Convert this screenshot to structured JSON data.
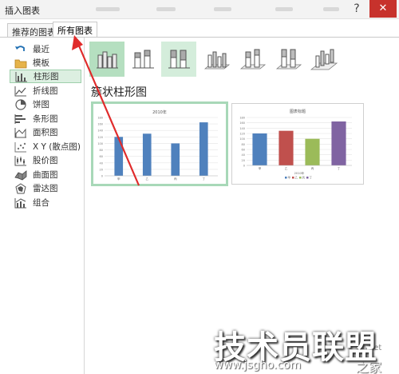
{
  "window": {
    "title": "插入图表",
    "help_label": "?",
    "close_label": "✕"
  },
  "tabs": [
    {
      "label": "推荐的图表"
    },
    {
      "label": "所有图表"
    }
  ],
  "sidebar": {
    "items": [
      {
        "label": "最近",
        "icon": "undo-icon",
        "color": "#1f6fb2"
      },
      {
        "label": "模板",
        "icon": "folder-icon",
        "color": "#d8a23a"
      },
      {
        "label": "柱形图",
        "icon": "column-chart-icon",
        "color": "#4a4a4a"
      },
      {
        "label": "折线图",
        "icon": "line-chart-icon",
        "color": "#4a4a4a"
      },
      {
        "label": "饼图",
        "icon": "pie-chart-icon",
        "color": "#4a4a4a"
      },
      {
        "label": "条形图",
        "icon": "bar-chart-icon",
        "color": "#4a4a4a"
      },
      {
        "label": "面积图",
        "icon": "area-chart-icon",
        "color": "#4a4a4a"
      },
      {
        "label": "X Y (散点图)",
        "icon": "scatter-chart-icon",
        "color": "#4a4a4a"
      },
      {
        "label": "股价图",
        "icon": "stock-chart-icon",
        "color": "#4a4a4a"
      },
      {
        "label": "曲面图",
        "icon": "surface-chart-icon",
        "color": "#4a4a4a"
      },
      {
        "label": "雷达图",
        "icon": "radar-chart-icon",
        "color": "#4a4a4a"
      },
      {
        "label": "组合",
        "icon": "combo-chart-icon",
        "color": "#4a4a4a"
      }
    ],
    "selected": "柱形图"
  },
  "chart_types": [
    {
      "icon": "clustered-column-icon"
    },
    {
      "icon": "stacked-column-icon"
    },
    {
      "icon": "percent-stacked-column-icon"
    },
    {
      "icon": "3d-clustered-column-icon"
    },
    {
      "icon": "3d-stacked-column-icon"
    },
    {
      "icon": "3d-percent-stacked-column-icon"
    },
    {
      "icon": "3d-column-icon"
    }
  ],
  "section_title": "簇状柱形图",
  "chart_data": [
    {
      "type": "bar",
      "title": "2010年",
      "categories": [
        "甲",
        "乙",
        "丙",
        "丁"
      ],
      "values": [
        120,
        130,
        100,
        165
      ],
      "ylim": [
        0,
        180
      ],
      "yticks": [
        0,
        20,
        40,
        60,
        80,
        100,
        120,
        140,
        160,
        180
      ],
      "bar_color": "#4f81bd",
      "grid": true,
      "legend": "none"
    },
    {
      "type": "bar",
      "title": "图表标题",
      "categories": [
        "甲",
        "乙",
        "丙",
        "丁"
      ],
      "values": [
        120,
        130,
        100,
        165
      ],
      "colors": [
        "#4f81bd",
        "#c0504d",
        "#9bbb59",
        "#8064a2"
      ],
      "ylim": [
        0,
        180
      ],
      "yticks": [
        0,
        20,
        40,
        60,
        80,
        100,
        120,
        140,
        160,
        180
      ],
      "xlabel": "2010年",
      "grid": true,
      "legend": "bottom"
    }
  ],
  "watermark": {
    "brand": "技术员联盟",
    "url": "www.jsgho.com",
    "fragment": "51.net",
    "fragment2": "之家"
  }
}
